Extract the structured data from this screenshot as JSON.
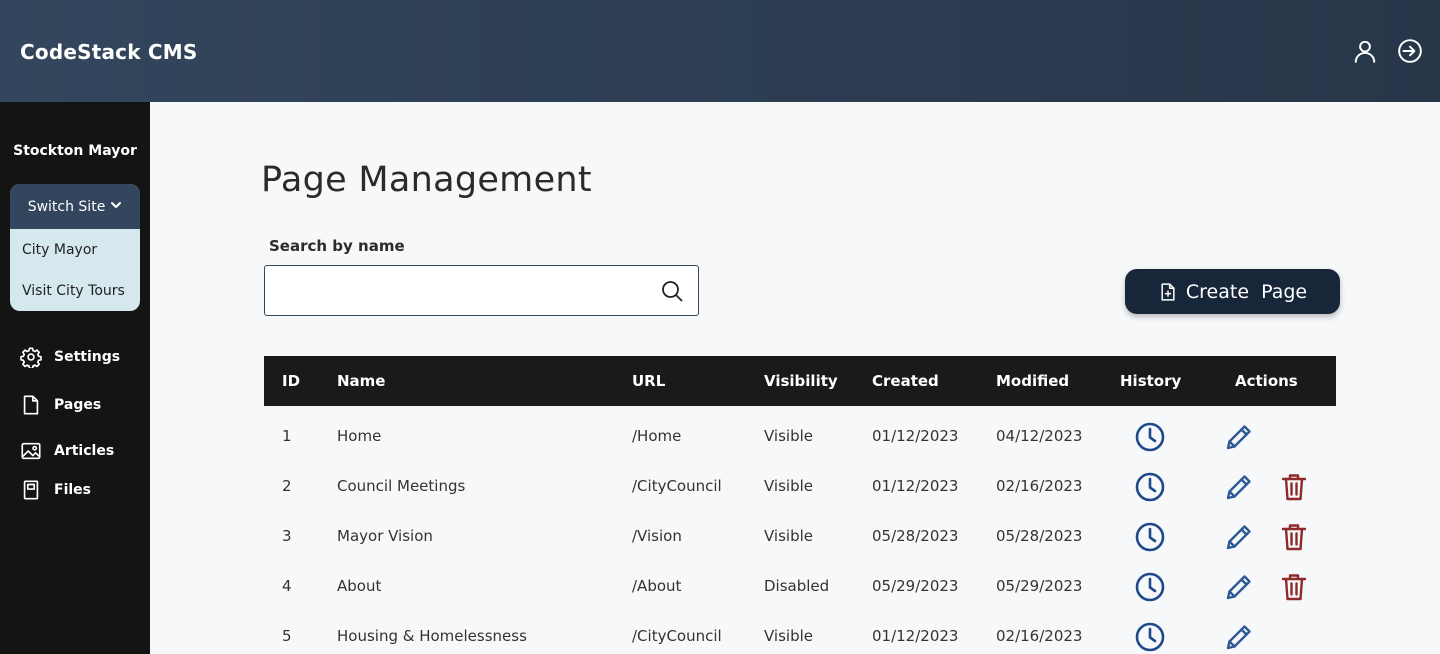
{
  "app": {
    "brand": "CodeStack CMS"
  },
  "header": {
    "user_icon": "user-icon",
    "logout_icon": "sign-out-icon"
  },
  "sidebar": {
    "site_name": "Stockton Mayor",
    "switch_label": "Switch Site",
    "sites": [
      "City Mayor",
      "Visit City Tours"
    ],
    "nav": [
      {
        "label": "Settings",
        "icon": "gear-icon"
      },
      {
        "label": "Pages",
        "icon": "document-icon"
      },
      {
        "label": "Articles",
        "icon": "image-icon"
      },
      {
        "label": "Files",
        "icon": "file-icon"
      }
    ]
  },
  "main": {
    "title": "Page Management",
    "search_label": "Search by name",
    "search_value": "",
    "create_label": "Create  Page"
  },
  "table": {
    "headers": [
      "ID",
      "Name",
      "URL",
      "Visibility",
      "Created",
      "Modified",
      "History",
      "Actions"
    ],
    "rows": [
      {
        "id": "1",
        "name": "Home",
        "url": "/Home",
        "visibility": "Visible",
        "created": "01/12/2023",
        "modified": "04/12/2023",
        "deletable": false
      },
      {
        "id": "2",
        "name": "Council Meetings",
        "url": "/CityCouncil",
        "visibility": "Visible",
        "created": "01/12/2023",
        "modified": "02/16/2023",
        "deletable": true
      },
      {
        "id": "3",
        "name": "Mayor Vision",
        "url": "/Vision",
        "visibility": "Visible",
        "created": "05/28/2023",
        "modified": "05/28/2023",
        "deletable": true
      },
      {
        "id": "4",
        "name": "About",
        "url": "/About",
        "visibility": "Disabled",
        "created": "05/29/2023",
        "modified": "05/29/2023",
        "deletable": true
      },
      {
        "id": "5",
        "name": "Housing & Homelessness",
        "url": "/CityCouncil",
        "visibility": "Visible",
        "created": "01/12/2023",
        "modified": "02/16/2023",
        "deletable": false
      }
    ]
  },
  "colors": {
    "history": "#1f4a8a",
    "edit": "#2d5a94",
    "delete": "#8e2a2a",
    "header_bg": "#2f4157",
    "sidebar_bg": "#141414"
  }
}
